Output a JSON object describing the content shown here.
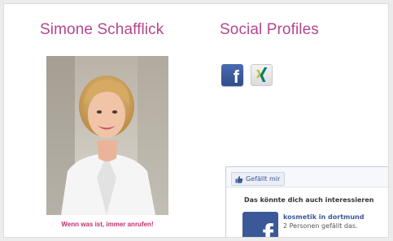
{
  "profile": {
    "name": "Simone Schafflick",
    "caption": "Wenn was ist, immer anrufen!"
  },
  "social": {
    "heading": "Social Profiles",
    "icons": [
      {
        "name": "facebook-icon",
        "glyph": "f"
      },
      {
        "name": "xing-icon"
      }
    ]
  },
  "facebook_box": {
    "like_label": "Gefällt mir",
    "suggestion_heading": "Das könnte dich auch interessieren",
    "page_logo_glyph": "f",
    "page_name": "kosmetik in dortmund",
    "likes_text": "2 Personen gefällt das."
  },
  "colors": {
    "heading": "#b4478f",
    "caption": "#c42f6f",
    "facebook_blue": "#3b5998",
    "xing_green": "#0a7a6c",
    "xing_lime": "#b6c52a"
  }
}
